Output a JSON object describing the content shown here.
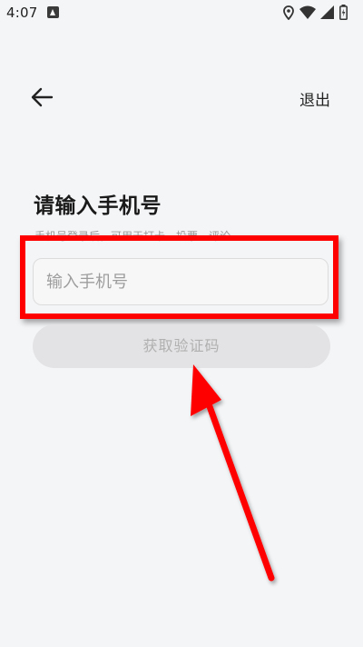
{
  "status_bar": {
    "time": "4:07",
    "app_icon": "a-notification-icon",
    "icons": [
      "location-icon",
      "wifi-icon",
      "cellular-signal-icon",
      "battery-icon"
    ]
  },
  "header": {
    "back_icon": "arrow-left-icon",
    "exit_label": "退出"
  },
  "login": {
    "title": "请输入手机号",
    "subtitle": "手机号登录后，可用于打卡、投票、评论",
    "phone_placeholder": "输入手机号",
    "phone_value": "",
    "get_code_label": "获取验证码"
  },
  "annotation": {
    "highlight_color": "#ff0000",
    "arrow_color": "#ff0000"
  }
}
